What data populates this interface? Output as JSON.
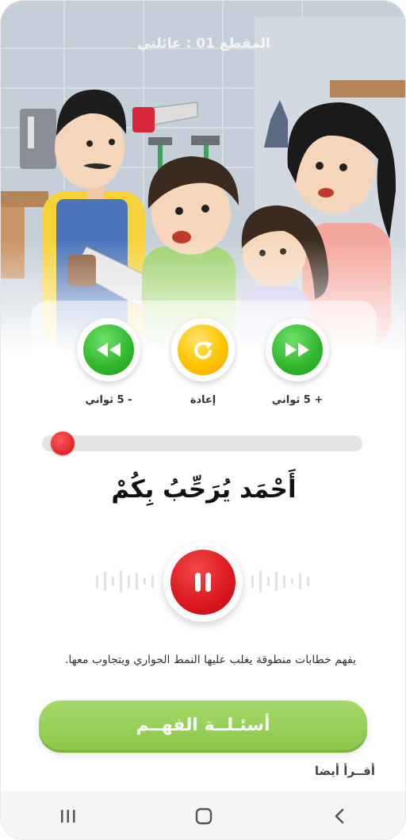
{
  "episode": {
    "title": "المقطع 01 : عائلتي"
  },
  "controls": {
    "rewind_label": "- 5 ثواني",
    "replay_label": "إعادة",
    "forward_label": "+ 5 ثواني"
  },
  "progress": {
    "fraction": 0.03
  },
  "sentence": {
    "text": "أَحْمَد يُرَحِّبُ بِكُمْ"
  },
  "player": {
    "state": "playing",
    "pause_icon": "pause-icon"
  },
  "description": {
    "text": "يفهم خطابات منطوقة يغلب عليها النمط الحواري ويتجاوب معها."
  },
  "cta": {
    "label": "أسئـلــة الفهــم"
  },
  "section": {
    "read_also": "أقــرأ أيضا"
  },
  "colors": {
    "accent_green": "#8cc84b",
    "control_green": "#2fb62b",
    "control_yellow": "#ffc400",
    "pause_red": "#d8141c"
  }
}
